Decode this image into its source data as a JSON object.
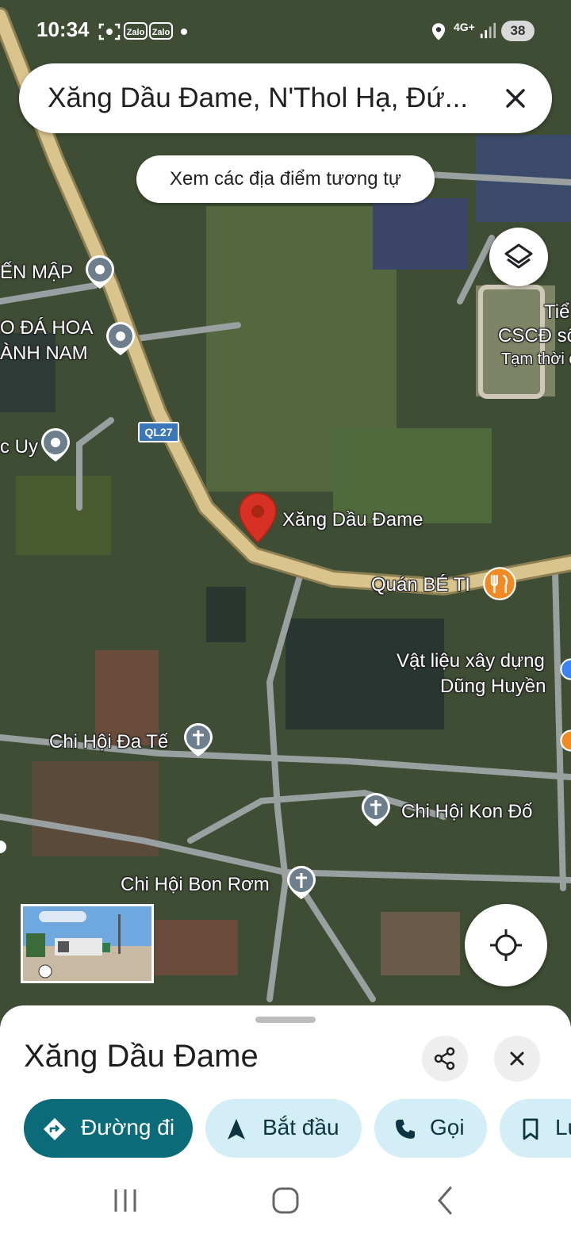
{
  "status_bar": {
    "time": "10:34",
    "zalo_1": "Zalo",
    "zalo_2": "Zalo",
    "network": "4G+",
    "battery": "38"
  },
  "search": {
    "query": "Xăng Dầu Đame, N'Thol Hạ, Đứ..."
  },
  "similar_places_label": "Xem các địa điểm tương tự",
  "map": {
    "route_shield": "QL27",
    "selected_place_label": "Xăng Dầu Đame",
    "labels": {
      "place_1": "ẾN MẬP",
      "place_2a": "O ĐÁ HOA",
      "place_2b": "ÀNH NAM",
      "place_3": "c Uy",
      "restaurant": "Quán BÉ TI",
      "building_a": "Vật liệu xây dựng",
      "building_b": "Dũng Huyền",
      "church_1": "Chi Hội Đa Tế",
      "church_2": "Chi Hội Kon Đố",
      "church_3": "Chi Hội Bon Rơm",
      "school_a": "Tiể",
      "school_b": "CSCĐ số",
      "school_c": "Tạm thời đ"
    }
  },
  "sheet": {
    "title": "Xăng Dầu Đame",
    "actions": {
      "directions": "Đường đi",
      "start": "Bắt đầu",
      "call": "Gọi",
      "save": "Lư"
    }
  },
  "colors": {
    "primary_chip": "#0b6b78",
    "secondary_chip": "#d3eef6",
    "pin_red": "#d93025",
    "road_yellow": "#d8c48c"
  }
}
